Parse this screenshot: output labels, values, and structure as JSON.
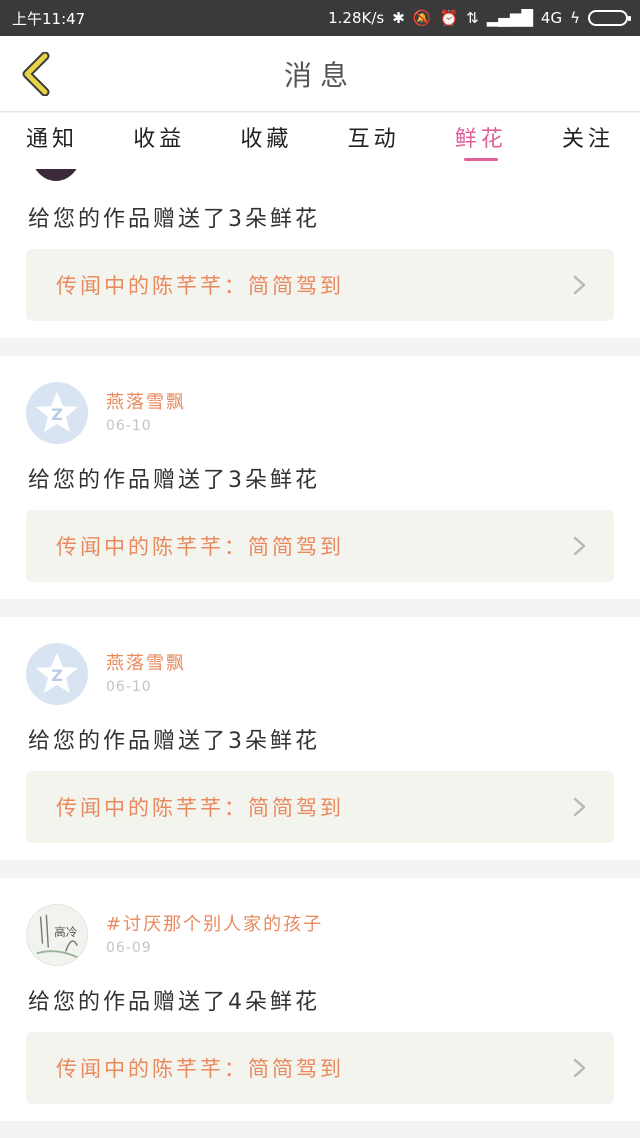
{
  "status_bar": {
    "time": "上午11:47",
    "speed": "1.28K/s",
    "network": "4G"
  },
  "header": {
    "title": "消息"
  },
  "tabs": [
    {
      "label": "通知",
      "active": false
    },
    {
      "label": "收益",
      "active": false
    },
    {
      "label": "收藏",
      "active": false
    },
    {
      "label": "互动",
      "active": false
    },
    {
      "label": "鲜花",
      "active": true
    },
    {
      "label": "关注",
      "active": false
    }
  ],
  "messages": [
    {
      "message": "给您的作品赠送了3朵鲜花",
      "work_title": "传闻中的陈芊芊：简简驾到"
    },
    {
      "username": "燕落雪飘",
      "date": "06-10",
      "message": "给您的作品赠送了3朵鲜花",
      "work_title": "传闻中的陈芊芊：简简驾到"
    },
    {
      "username": "燕落雪飘",
      "date": "06-10",
      "message": "给您的作品赠送了3朵鲜花",
      "work_title": "传闻中的陈芊芊：简简驾到"
    },
    {
      "username": "#讨厌那个别人家的孩子",
      "date": "06-09",
      "message": "给您的作品赠送了4朵鲜花",
      "work_title": "传闻中的陈芊芊：简简驾到"
    }
  ],
  "colors": {
    "accent": "#e0609a",
    "orange_text": "#e98a5e",
    "back_arrow": "#e8d24a"
  }
}
